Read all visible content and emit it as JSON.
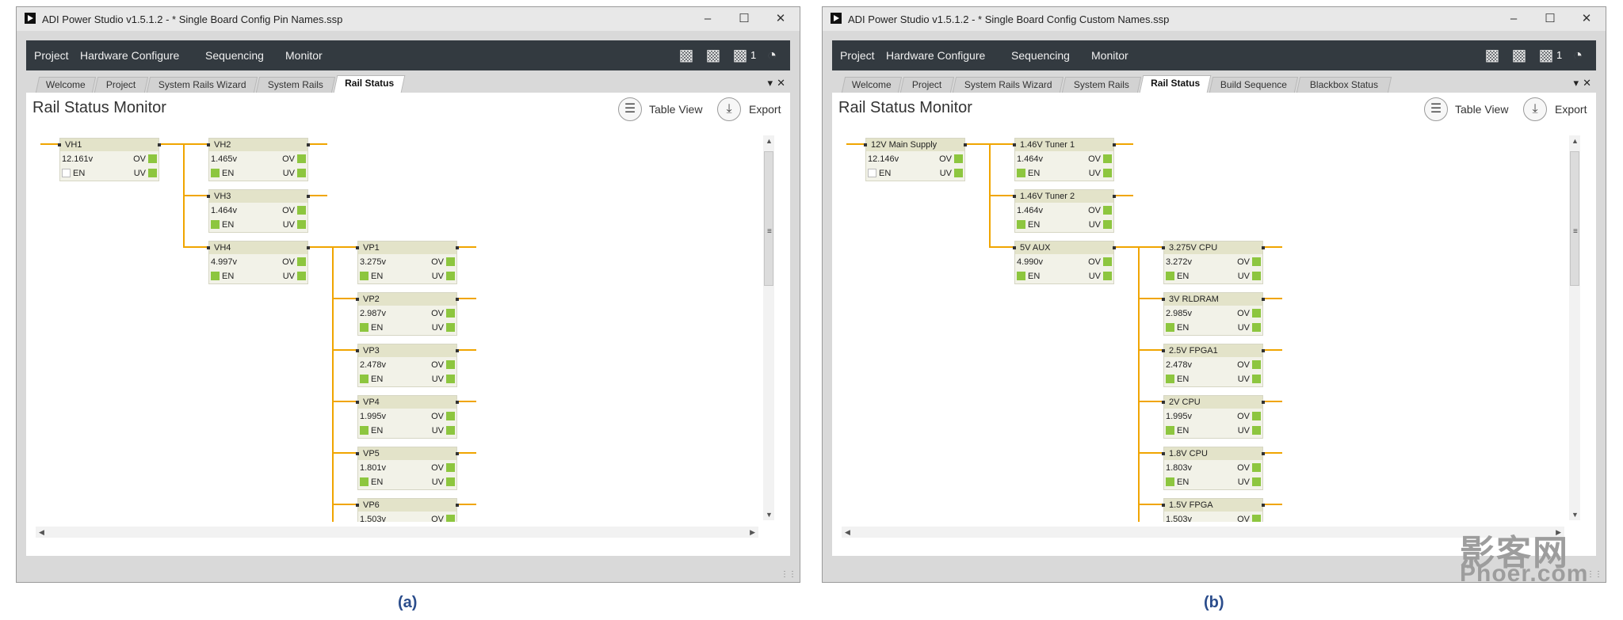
{
  "windows": [
    {
      "title": "ADI Power Studio v1.5.1.2 - * Single Board Config Pin Names.ssp",
      "menu": [
        "Project",
        "Hardware Configure",
        "Sequencing",
        "Monitor"
      ],
      "device_count": "1",
      "tabs": [
        "Welcome",
        "Project",
        "System Rails Wizard",
        "System Rails",
        "Rail Status"
      ],
      "active_tab": "Rail Status",
      "panel_title": "Rail Status Monitor",
      "table_view": "Table View",
      "export": "Export",
      "labels": {
        "ov": "OV",
        "uv": "UV",
        "en": "EN"
      },
      "rails": [
        {
          "name": "VH1",
          "voltage": "12.161v",
          "en_on": false
        },
        {
          "name": "VH2",
          "voltage": "1.465v",
          "en_on": true
        },
        {
          "name": "VH3",
          "voltage": "1.464v",
          "en_on": true
        },
        {
          "name": "VH4",
          "voltage": "4.997v",
          "en_on": true
        },
        {
          "name": "VP1",
          "voltage": "3.275v",
          "en_on": true
        },
        {
          "name": "VP2",
          "voltage": "2.987v",
          "en_on": true
        },
        {
          "name": "VP3",
          "voltage": "2.478v",
          "en_on": true
        },
        {
          "name": "VP4",
          "voltage": "1.995v",
          "en_on": true
        },
        {
          "name": "VP5",
          "voltage": "1.801v",
          "en_on": true
        },
        {
          "name": "VP6",
          "voltage": "1.503v",
          "en_on": true
        }
      ],
      "caption": "(a)"
    },
    {
      "title": "ADI Power Studio v1.5.1.2 - * Single Board Config Custom Names.ssp",
      "menu": [
        "Project",
        "Hardware Configure",
        "Sequencing",
        "Monitor"
      ],
      "device_count": "1",
      "tabs": [
        "Welcome",
        "Project",
        "System Rails Wizard",
        "System Rails",
        "Rail Status",
        "Build Sequence",
        "Blackbox Status"
      ],
      "active_tab": "Rail Status",
      "panel_title": "Rail Status Monitor",
      "table_view": "Table View",
      "export": "Export",
      "labels": {
        "ov": "OV",
        "uv": "UV",
        "en": "EN"
      },
      "rails": [
        {
          "name": "12V Main Supply",
          "voltage": "12.146v",
          "en_on": false
        },
        {
          "name": "1.46V Tuner 1",
          "voltage": "1.464v",
          "en_on": true
        },
        {
          "name": "1.46V Tuner 2",
          "voltage": "1.464v",
          "en_on": true
        },
        {
          "name": "5V AUX",
          "voltage": "4.990v",
          "en_on": true
        },
        {
          "name": "3.275V CPU",
          "voltage": "3.272v",
          "en_on": true
        },
        {
          "name": "3V RLDRAM",
          "voltage": "2.985v",
          "en_on": true
        },
        {
          "name": "2.5V FPGA1",
          "voltage": "2.478v",
          "en_on": true
        },
        {
          "name": "2V CPU",
          "voltage": "1.995v",
          "en_on": true
        },
        {
          "name": "1.8V CPU",
          "voltage": "1.803v",
          "en_on": true
        },
        {
          "name": "1.5V FPGA",
          "voltage": "1.503v",
          "en_on": true
        }
      ],
      "caption": "(b)"
    }
  ],
  "icons": {
    "minimize": "minimize-icon",
    "maximize": "maximize-icon",
    "close": "close-icon"
  },
  "watermark": {
    "line1": "影客网",
    "line2": "Phoer.com"
  }
}
